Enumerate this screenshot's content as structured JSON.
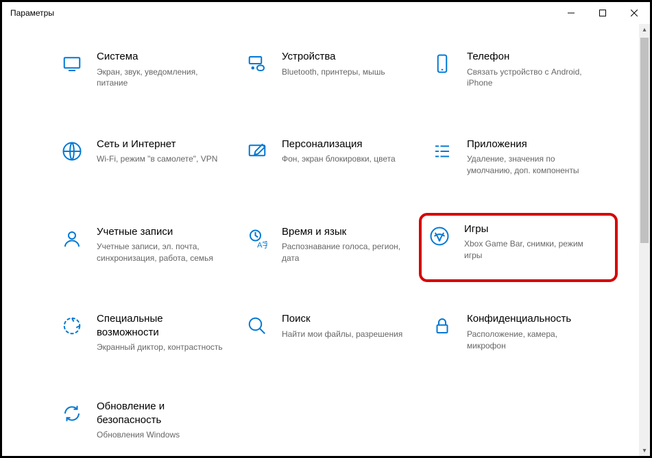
{
  "window": {
    "title": "Параметры"
  },
  "tiles": [
    {
      "title": "Система",
      "desc": "Экран, звук, уведомления, питание"
    },
    {
      "title": "Устройства",
      "desc": "Bluetooth, принтеры, мышь"
    },
    {
      "title": "Телефон",
      "desc": "Связать устройство с Android, iPhone"
    },
    {
      "title": "Сеть и Интернет",
      "desc": "Wi-Fi, режим \"в самолете\", VPN"
    },
    {
      "title": "Персонализация",
      "desc": "Фон, экран блокировки, цвета"
    },
    {
      "title": "Приложения",
      "desc": "Удаление, значения по умолчанию, доп. компоненты"
    },
    {
      "title": "Учетные записи",
      "desc": "Учетные записи, эл. почта, синхронизация, работа, семья"
    },
    {
      "title": "Время и язык",
      "desc": "Распознавание голоса, регион, дата"
    },
    {
      "title": "Игры",
      "desc": "Xbox Game Bar, снимки, режим игры"
    },
    {
      "title": "Специальные возможности",
      "desc": "Экранный диктор, контрастность"
    },
    {
      "title": "Поиск",
      "desc": "Найти мои файлы, разрешения"
    },
    {
      "title": "Конфиденциальность",
      "desc": "Расположение, камера, микрофон"
    },
    {
      "title": "Обновление и безопасность",
      "desc": "Обновления Windows"
    }
  ]
}
